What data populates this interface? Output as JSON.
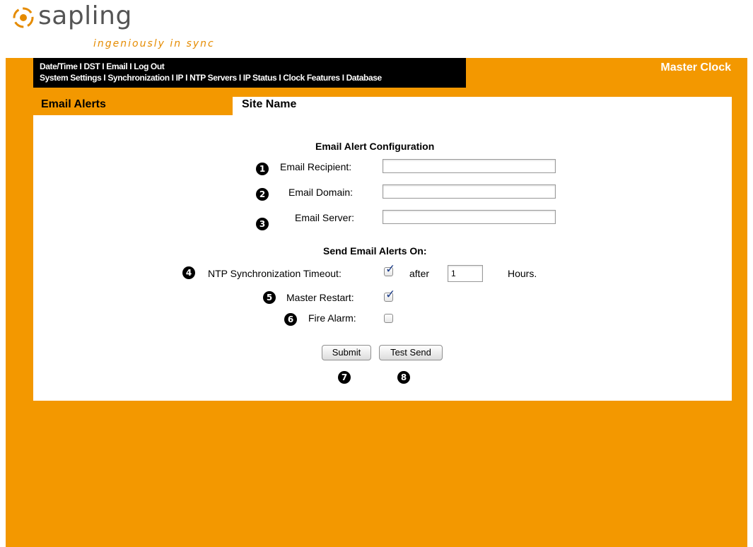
{
  "brand": {
    "name": "sapling",
    "tagline": "ingeniously in sync",
    "logo_color": "#e58b00"
  },
  "nav": {
    "row1": [
      "Date/Time",
      "DST",
      "Email",
      "Log Out"
    ],
    "row2": [
      "System Settings",
      "Synchronization",
      "IP",
      "NTP Servers",
      "IP Status",
      "Clock Features",
      "Database"
    ],
    "separator": "I"
  },
  "header": {
    "device_title": "Master Clock",
    "section_title": "Email Alerts",
    "site_name": "Site Name"
  },
  "config": {
    "heading": "Email Alert Configuration",
    "fields": [
      {
        "badge": "1",
        "label": "Email Recipient:",
        "value": ""
      },
      {
        "badge": "2",
        "label": "Email Domain:",
        "value": ""
      },
      {
        "badge": "3",
        "label": "Email Server:",
        "value": ""
      }
    ]
  },
  "alerts": {
    "heading": "Send Email Alerts On:",
    "ntp": {
      "badge": "4",
      "label": "NTP Synchronization Timeout:",
      "checked": true,
      "after_label": "after",
      "hours_value": "1",
      "hours_label": "Hours."
    },
    "restart": {
      "badge": "5",
      "label": "Master Restart:",
      "checked": true
    },
    "fire": {
      "badge": "6",
      "label": "Fire Alarm:",
      "checked": false
    }
  },
  "actions": {
    "submit": {
      "label": "Submit",
      "badge": "7"
    },
    "test": {
      "label": "Test Send",
      "badge": "8"
    }
  },
  "colors": {
    "accent": "#f39800",
    "nav_bg": "#000000",
    "checkmark": "#1f3f8a"
  }
}
